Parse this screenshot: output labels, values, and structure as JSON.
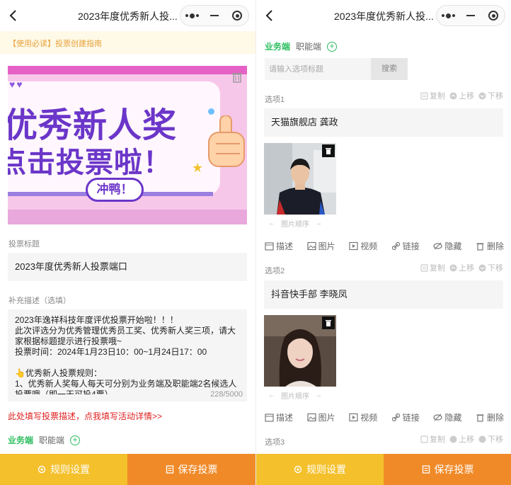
{
  "header": {
    "title": "2023年度优秀新人投...",
    "back_icon": "chevron-left-icon",
    "capsule_icons": [
      "more-dots-icon",
      "minimize-icon",
      "close-target-icon"
    ]
  },
  "left": {
    "notice": "【使用必读】投票创建指南",
    "banner": {
      "line1": "优秀新人奖",
      "line2": "点击投票啦！",
      "pill": "冲鸭！"
    },
    "vote_title_label": "投票标题",
    "vote_title_value": "2023年度优秀新人投票端口",
    "desc_label": "补充描述（选填）",
    "desc_value": "2023年逸祥科技年度评优投票开始啦！！！\n此次评选分为优秀管理优秀员工奖、优秀新人奖三项，请大家根据标题提示进行投票哦~\n投票时间：2024年1月23日10：00~1月24日17：00\n\n👆优秀新人投票规则：\n1、优秀新人奖每人每天可分别为业务端及职能端2名候选人投票哦（即一天可投4票）",
    "desc_counter": "228/5000",
    "red_hint": "此处填写投票描述，点我填写活动详情>>",
    "tabs": [
      "业务端",
      "职能端"
    ]
  },
  "right": {
    "tabs": [
      "业务端",
      "职能端"
    ],
    "search_placeholder": "请输入选项标题",
    "search_button": "搜索",
    "option_actions": [
      "复制",
      "上移",
      "下移"
    ],
    "tools": [
      "描述",
      "图片",
      "视频",
      "链接",
      "隐藏",
      "删除"
    ],
    "order_label": "图片顺序",
    "options": [
      {
        "label": "选项1",
        "value": "天猫旗舰店 龚政"
      },
      {
        "label": "选项2",
        "value": "抖音快手部 李晓凤"
      },
      {
        "label": "选项3",
        "value": ""
      }
    ]
  },
  "bottom": {
    "rule_label": "规则设置",
    "save_label": "保存投票"
  },
  "colors": {
    "accent_green": "#2dbe60",
    "rule_yellow": "#f4c02b",
    "save_orange": "#f08a28",
    "hint_red": "#e02020",
    "notice_text": "#e6a23c"
  }
}
